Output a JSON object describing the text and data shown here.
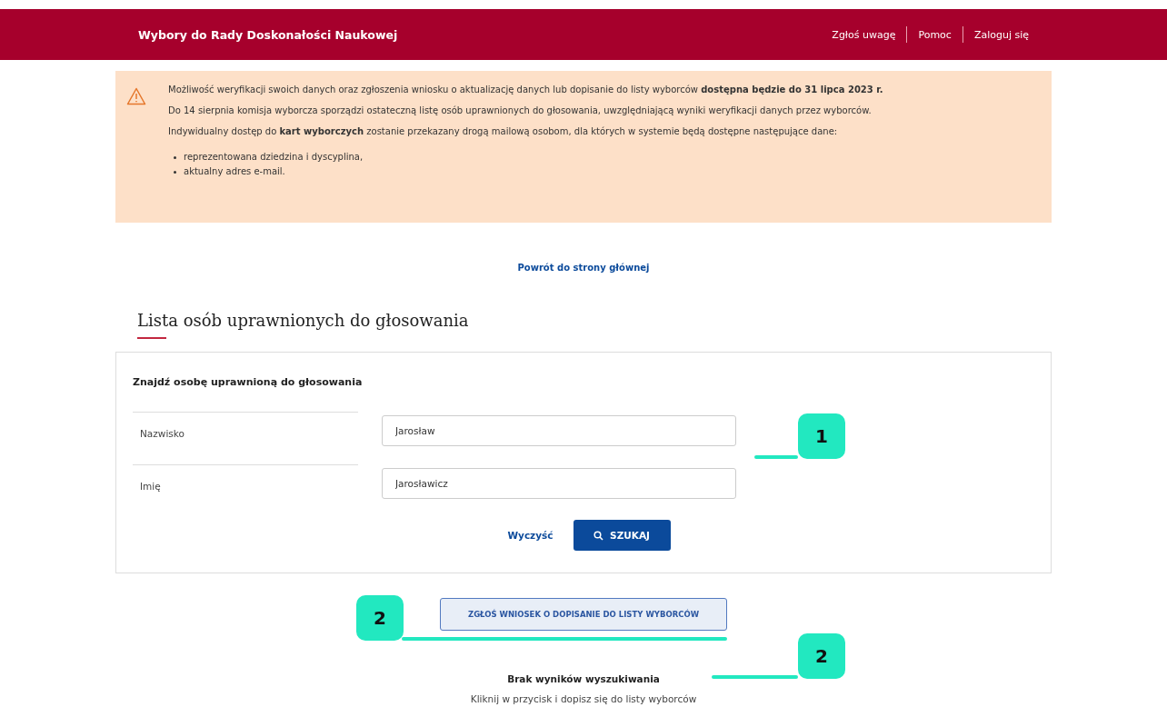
{
  "header": {
    "title": "Wybory do Rady Doskonałości Naukowej",
    "links": [
      "Zgłoś uwagę",
      "Pomoc",
      "Zaloguj się"
    ]
  },
  "notice": {
    "paragraphs": [
      "Możliwość weryfikacji swoich danych oraz zgłoszenia wniosku o aktualizację danych lub dopisanie do listy wyborców **dostępna będzie do 31 lipca 2023 r.**",
      "Do 14 sierpnia komisja wyborcza sporządzi ostateczną listę osób uprawnionych do głosowania, uwzględniającą wyniki weryfikacji danych przez wyborców.",
      "Indywidualny dostęp do **kart wyborczych** zostanie przekazany drogą mailową osobom, dla których w systemie będą dostępne następujące dane:"
    ],
    "bullets": [
      "reprezentowana dziedzina i dyscyplina,",
      "aktualny adres e-mail."
    ]
  },
  "back_link": "Powrót do strony głównej",
  "page_title": "Lista osób uprawnionych do głosowania",
  "search": {
    "title": "Znajdź osobę uprawnioną do głosowania",
    "fields": [
      {
        "label": "Nazwisko",
        "value": "Jarosław"
      },
      {
        "label": "Imię",
        "value": "Jarosławicz"
      }
    ],
    "clear": "Wyczyść",
    "submit": "SZUKAJ"
  },
  "request_button": "ZGŁOŚ WNIOSEK O DOPISANIE DO LISTY WYBORCÓW",
  "empty": {
    "title": "Brak wyników wyszukiwania",
    "text": "Kliknij w przycisk i dopisz się do listy wyborców"
  },
  "callouts": [
    {
      "label": "1",
      "kind": "right"
    },
    {
      "label": "2",
      "kind": "left"
    },
    {
      "label": "2",
      "kind": "right"
    }
  ]
}
